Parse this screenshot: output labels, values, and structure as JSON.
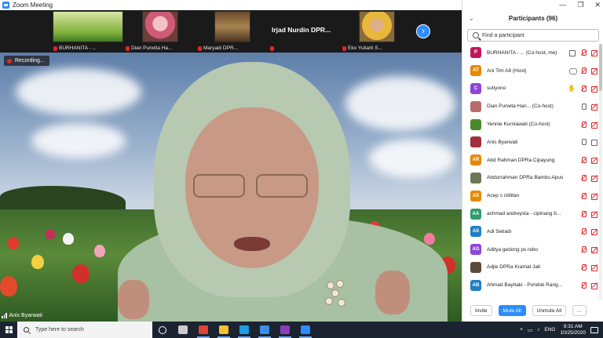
{
  "window": {
    "title": "Zoom Meeting"
  },
  "filmstrip": {
    "thumbs": [
      {
        "name": "BURHANITA - ..."
      },
      {
        "name": "Dian Purwita Ha..."
      },
      {
        "name": "Maryadi DPR..."
      },
      {
        "name": "Irjad Nurdin DP..."
      },
      {
        "name": "Eko Yuliarti S..."
      }
    ],
    "big_name": "Irjad Nurdin DPR...",
    "next_icon": "chevron-right-icon"
  },
  "main_video": {
    "recording_label": "Recording...",
    "speaker_name": "Anis Byarwati"
  },
  "participants": {
    "title": "Participants (96)",
    "search_placeholder": "Find a participant",
    "list": [
      {
        "initials": "P",
        "color": "#c2185b",
        "name": "BURHANITA - ... (Co-host, me)",
        "icons": [
          "cam-on",
          "mic-off",
          "cam-off"
        ]
      },
      {
        "initials": "AT",
        "color": "#e68a00",
        "name": "Ani Tim A8 (Host)",
        "icons": [
          "share",
          "mic-off",
          "cam-off"
        ]
      },
      {
        "initials": "C",
        "color": "#8e44d8",
        "name": "sutiyono",
        "icons": [
          "hand",
          "mic-off",
          "cam-off"
        ]
      },
      {
        "initials": "",
        "color": "#b86b6b",
        "name": "Dian Purwita Han... (Co-host)",
        "icons": [
          "mic-on",
          "cam-off"
        ]
      },
      {
        "initials": "",
        "color": "#4a8a2a",
        "name": "Yennie Kurniawati (Co-host)",
        "icons": [
          "mic-off",
          "cam-off"
        ]
      },
      {
        "initials": "",
        "color": "#a0303a",
        "name": "Anis Byarwati",
        "icons": [
          "mic-on",
          "cam-on"
        ]
      },
      {
        "initials": "AR",
        "color": "#e68a00",
        "name": "Abd Rahman DPRa Cipayung",
        "icons": [
          "mic-off",
          "cam-off"
        ]
      },
      {
        "initials": "",
        "color": "#6b7a55",
        "name": "Abdurrahman DPRa Bambu Apus",
        "icons": [
          "mic-off",
          "cam-off"
        ]
      },
      {
        "initials": "AS",
        "color": "#e68a00",
        "name": "Acep s cililitan",
        "icons": [
          "mic-off",
          "cam-off"
        ]
      },
      {
        "initials": "AA",
        "color": "#2e9e6b",
        "name": "achmad andreysta - cipinang b...",
        "icons": [
          "mic-off",
          "cam-off"
        ]
      },
      {
        "initials": "AS",
        "color": "#1f7fc2",
        "name": "Adi Setiadi",
        "icons": [
          "mic-off",
          "cam-off"
        ]
      },
      {
        "initials": "AG",
        "color": "#8e44d8",
        "name": "Aditya gedong ps rebo",
        "icons": [
          "mic-off",
          "cam-off"
        ]
      },
      {
        "initials": "",
        "color": "#5a4a3a",
        "name": "Adjie DPRa Kramat Jati",
        "icons": [
          "mic-off",
          "cam-off"
        ]
      },
      {
        "initials": "AB",
        "color": "#1f7fc2",
        "name": "Ahmad Bayhaki - Pondok Rang...",
        "icons": [
          "mic-off",
          "cam-off"
        ]
      }
    ],
    "footer": {
      "invite": "Invite",
      "mute_all": "Mute All",
      "unmute_all": "Unmute All",
      "more": "..."
    }
  },
  "taskbar": {
    "search_placeholder": "Type here to search",
    "language": "ENG",
    "time": "9:31 AM",
    "date": "10/25/2020",
    "apps": [
      {
        "name": "task-view-icon",
        "color": "#cccccc"
      },
      {
        "name": "chrome-icon",
        "color": "#db4437"
      },
      {
        "name": "file-explorer-icon",
        "color": "#f2c230"
      },
      {
        "name": "edge-icon",
        "color": "#1b9de2"
      },
      {
        "name": "mail-icon",
        "color": "#3a8ee6"
      },
      {
        "name": "onenote-icon",
        "color": "#8a3fb8"
      },
      {
        "name": "zoom-icon",
        "color": "#2d8cff"
      }
    ]
  }
}
